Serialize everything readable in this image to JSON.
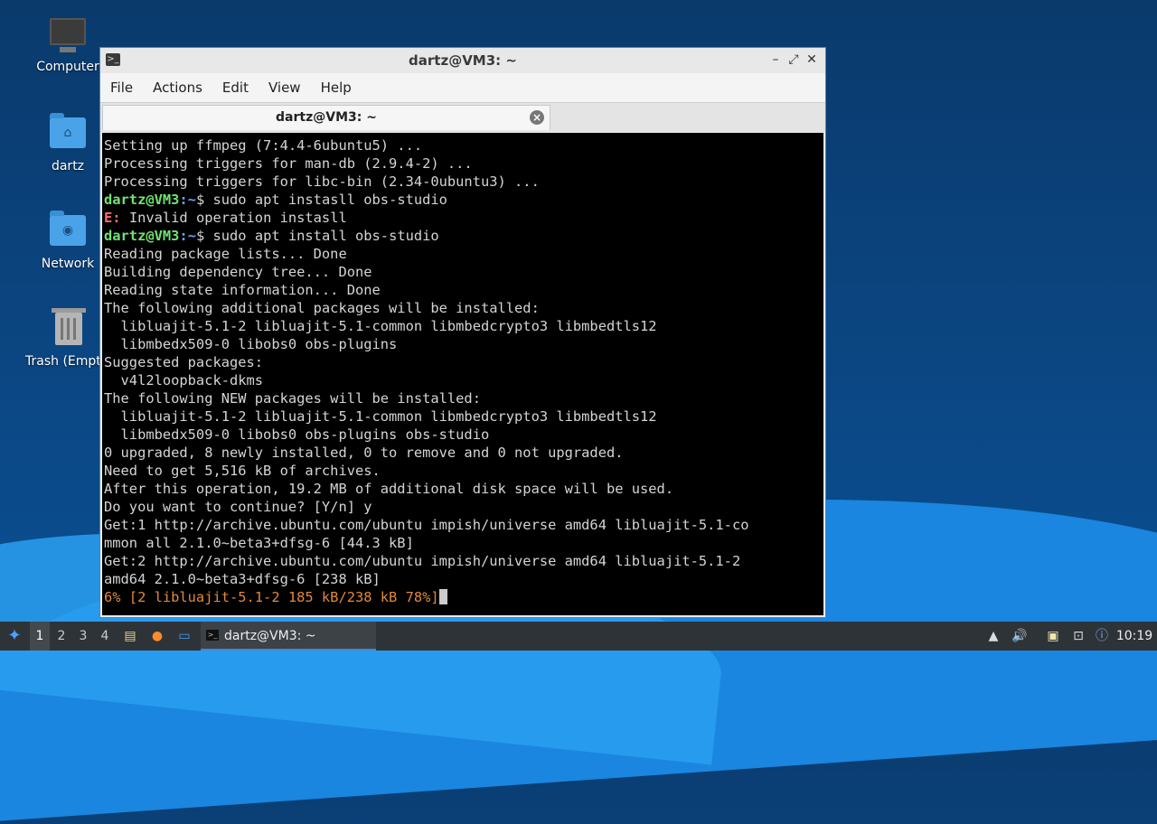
{
  "desktop": {
    "icons": [
      {
        "label": "Computer",
        "icon": "computer-icon"
      },
      {
        "label": "dartz",
        "icon": "home-folder-icon"
      },
      {
        "label": "Network",
        "icon": "network-folder-icon"
      },
      {
        "label": "Trash (Empty)",
        "icon": "trash-icon"
      }
    ]
  },
  "window": {
    "title": "dartz@VM3: ~",
    "menu": [
      "File",
      "Actions",
      "Edit",
      "View",
      "Help"
    ],
    "tab_title": "dartz@VM3: ~",
    "controls": {
      "minimize": "–",
      "maximize": "⤢",
      "close": "✕"
    }
  },
  "terminal": {
    "prompt_user": "dartz@VM3",
    "prompt_path": ":~",
    "lines": [
      "Setting up ffmpeg (7:4.4-6ubuntu5) ...",
      "Processing triggers for man-db (2.9.4-2) ...",
      "Processing triggers for libc-bin (2.34-0ubuntu3) ...",
      "$ sudo apt instasll obs-studio",
      "E:",
      " Invalid operation instasll",
      "$ sudo apt install obs-studio",
      "Reading package lists... Done",
      "Building dependency tree... Done",
      "Reading state information... Done",
      "The following additional packages will be installed:",
      "  libluajit-5.1-2 libluajit-5.1-common libmbedcrypto3 libmbedtls12",
      "  libmbedx509-0 libobs0 obs-plugins",
      "Suggested packages:",
      "  v4l2loopback-dkms",
      "The following NEW packages will be installed:",
      "  libluajit-5.1-2 libluajit-5.1-common libmbedcrypto3 libmbedtls12",
      "  libmbedx509-0 libobs0 obs-plugins obs-studio",
      "0 upgraded, 8 newly installed, 0 to remove and 0 not upgraded.",
      "Need to get 5,516 kB of archives.",
      "After this operation, 19.2 MB of additional disk space will be used.",
      "Do you want to continue? [Y/n] y",
      "Get:1 http://archive.ubuntu.com/ubuntu impish/universe amd64 libluajit-5.1-co",
      "mmon all 2.1.0~beta3+dfsg-6 [44.3 kB]",
      "Get:2 http://archive.ubuntu.com/ubuntu impish/universe amd64 libluajit-5.1-2",
      "amd64 2.1.0~beta3+dfsg-6 [238 kB]",
      "6% [2 libluajit-5.1-2 185 kB/238 kB 78%]"
    ]
  },
  "taskbar": {
    "workspaces": [
      "1",
      "2",
      "3",
      "4"
    ],
    "active_workspace": "1",
    "task_label": "dartz@VM3: ~",
    "clock": "10:19"
  }
}
